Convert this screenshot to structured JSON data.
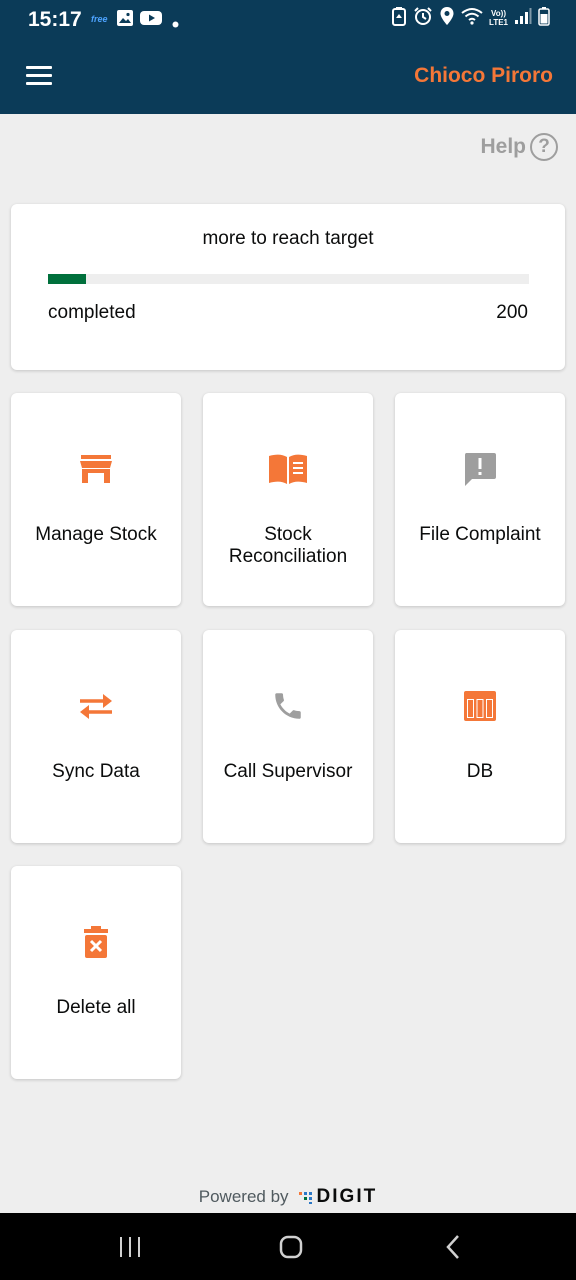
{
  "status_bar": {
    "time": "15:17",
    "free_tag": "free",
    "volte_top": "Vo))",
    "volte_bottom": "LTE1"
  },
  "app_bar": {
    "user_name": "Chioco Piroro",
    "menu_icon": "hamburger-menu-icon"
  },
  "help": {
    "label": "Help",
    "icon_glyph": "?"
  },
  "progress": {
    "message": "more to reach target",
    "completed_label": "completed",
    "target": "200",
    "fraction": 0.08,
    "fill_color": "#00703c"
  },
  "tiles": [
    {
      "label": "Manage Stock",
      "icon": "store-icon"
    },
    {
      "label": "Stock Reconciliation",
      "icon": "open-book-icon"
    },
    {
      "label": "File Complaint",
      "icon": "feedback-icon"
    },
    {
      "label": "Sync Data",
      "icon": "sync-arrows-icon"
    },
    {
      "label": "Call Supervisor",
      "icon": "phone-icon"
    },
    {
      "label": "DB",
      "icon": "table-icon"
    },
    {
      "label": "Delete all",
      "icon": "delete-icon"
    }
  ],
  "footer": {
    "powered_by": "Powered by",
    "brand": "DIGIT"
  },
  "colors": {
    "header": "#0b3b58",
    "accent": "#f47738",
    "icon_gray": "#9e9e9e",
    "background": "#eeeeee"
  }
}
